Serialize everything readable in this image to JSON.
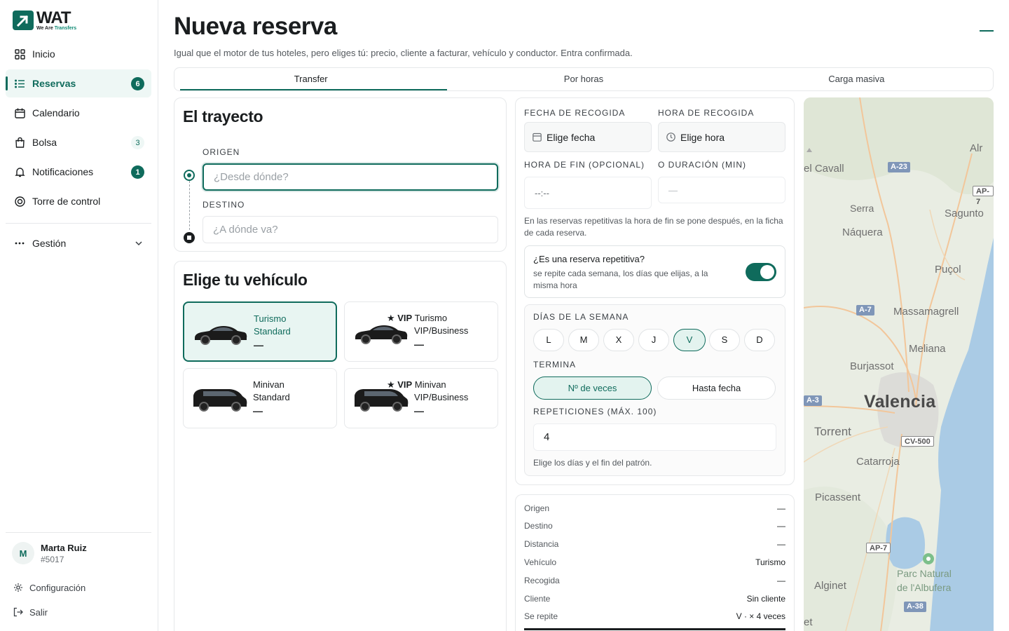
{
  "brand": {
    "name": "WAT",
    "tagline_a": "We Are ",
    "tagline_b": "Transfers"
  },
  "nav": {
    "items": [
      {
        "label": "Inicio",
        "icon": "grid-icon"
      },
      {
        "label": "Reservas",
        "icon": "list-icon",
        "badge": "6"
      },
      {
        "label": "Calendario",
        "icon": "calendar-icon"
      },
      {
        "label": "Bolsa",
        "icon": "bag-icon",
        "badge": "3"
      },
      {
        "label": "Notificaciones",
        "icon": "bell-icon",
        "badge": "1"
      },
      {
        "label": "Torre de control",
        "icon": "target-icon"
      }
    ],
    "group": "Gestión"
  },
  "user": {
    "initial": "M",
    "name": "Marta Ruiz",
    "id": "#5017"
  },
  "footer": {
    "settings": "Configuración",
    "logout": "Salir"
  },
  "page": {
    "title": "Nueva reserva",
    "subtitle": "Igual que el motor de tus hoteles, pero eliges tú: precio, cliente a facturar, vehículo y conductor. Entra confirmada."
  },
  "tabs": [
    "Transfer",
    "Por horas",
    "Carga masiva"
  ],
  "route": {
    "title": "El trayecto",
    "origin_label": "ORIGEN",
    "origin_placeholder": "¿Desde dónde?",
    "dest_label": "DESTINO",
    "dest_placeholder": "¿A dónde va?"
  },
  "vehicles": {
    "title": "Elige tu vehículo",
    "items": [
      {
        "vip": "",
        "line1": "Turismo",
        "line2": "Standard",
        "price": "—"
      },
      {
        "vip": "★ VIP",
        "line1": "Turismo",
        "line2": "VIP/Business",
        "price": "—"
      },
      {
        "vip": "",
        "line1": "Minivan",
        "line2": "Standard",
        "price": "—"
      },
      {
        "vip": "★ VIP",
        "line1": "Minivan",
        "line2": "VIP/Business",
        "price": "—"
      }
    ]
  },
  "schedule": {
    "date_label": "FECHA DE RECOGIDA",
    "date_value": "Elige fecha",
    "time_label": "HORA DE RECOGIDA",
    "time_value": "Elige hora",
    "end_label": "HORA DE FIN (OPCIONAL)",
    "end_value": "--:--",
    "dur_label": "O DURACIÓN (MIN)",
    "dur_value": "—",
    "help": "En las reservas repetitivas la hora de fin se pone después, en la ficha de cada reserva."
  },
  "repeat": {
    "question": "¿Es una reserva repetitiva?",
    "desc": "se repite cada semana, los días que elijas, a la misma hora",
    "enabled": true,
    "days_label": "DÍAS DE LA SEMANA",
    "days": [
      "L",
      "M",
      "X",
      "J",
      "V",
      "S",
      "D"
    ],
    "selected_day": "V",
    "ends_label": "TERMINA",
    "ends_options": [
      "Nº de veces",
      "Hasta fecha"
    ],
    "reps_label": "REPETICIONES (MÁX. 100)",
    "reps_value": "4",
    "hint": "Elige los días y el fin del patrón."
  },
  "summary": [
    {
      "k": "Origen",
      "v": "—"
    },
    {
      "k": "Destino",
      "v": "—"
    },
    {
      "k": "Distancia",
      "v": "—"
    },
    {
      "k": "Vehículo",
      "v": "Turismo"
    },
    {
      "k": "Recogida",
      "v": "—"
    },
    {
      "k": "Cliente",
      "v": "Sin cliente"
    },
    {
      "k": "Se repite",
      "v": "V · × 4 veces"
    }
  ],
  "map": {
    "places": [
      "Alr",
      "el Cavall",
      "Serra",
      "Sagunto",
      "Náquera",
      "Puçol",
      "Massamagrell",
      "Meliana",
      "Burjassot",
      "Valencia",
      "Torrent",
      "Catarroja",
      "Picassent",
      "Alginet",
      "Parc Natural",
      "de l'Albufera",
      "et"
    ],
    "roads": [
      "A-23",
      "AP-7",
      "A-7",
      "A-3",
      "CV-500",
      "AP-7",
      "A-38"
    ]
  },
  "colors": {
    "accent": "#0f6b5c",
    "accent_soft": "#e8f5f2"
  }
}
